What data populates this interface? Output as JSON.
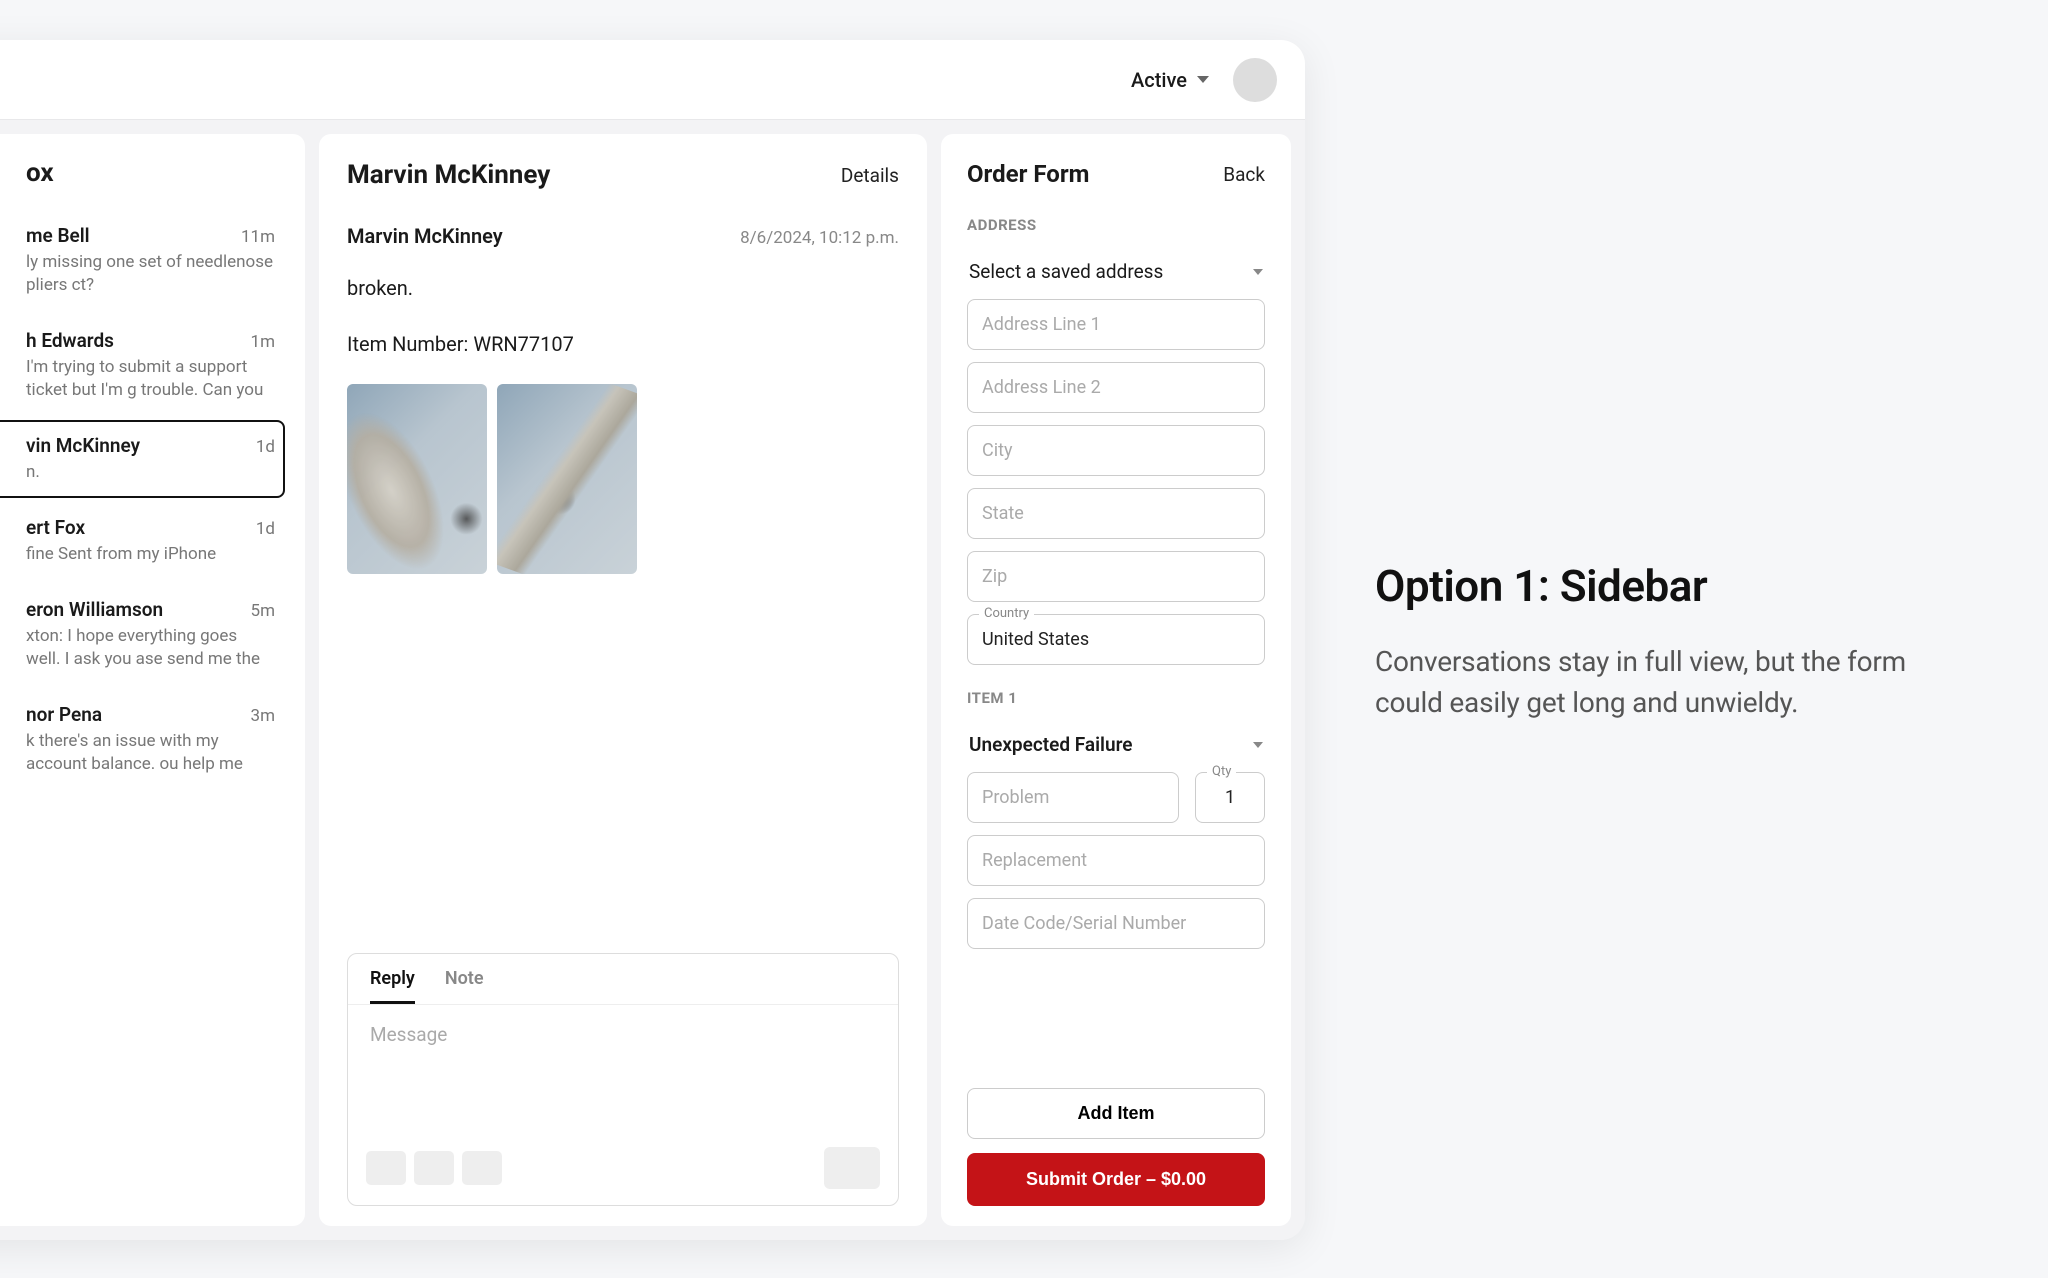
{
  "annotation": {
    "title": "Option 1: Sidebar",
    "body": "Conversations stay in full view, but the form could easily get long and unwieldy."
  },
  "header": {
    "status_label": "Active"
  },
  "inbox": {
    "title": "ox",
    "items": [
      {
        "name": "me Bell",
        "time": "11m",
        "preview": "ly missing one set of needlenose pliers ct?",
        "selected": false
      },
      {
        "name": "h Edwards",
        "time": "1m",
        "preview": "I'm trying to submit a support ticket but I'm g trouble. Can you assist me with this?",
        "selected": false
      },
      {
        "name": "vin McKinney",
        "time": "1d",
        "preview": "n.",
        "selected": true
      },
      {
        "name": "ert Fox",
        "time": "1d",
        "preview": "fine  Sent from my iPhone",
        "selected": false
      },
      {
        "name": "eron Williamson",
        "time": "5m",
        "preview": "xton:  I hope everything goes well. I ask you ase send me the invoice for this order.",
        "selected": false
      },
      {
        "name": "nor Pena",
        "time": "3m",
        "preview": "k there's an issue with my account balance. ou help me figure out what's going on?",
        "selected": false
      }
    ]
  },
  "conversation": {
    "title": "Marvin McKinney",
    "details_label": "Details",
    "message": {
      "author": "Marvin McKinney",
      "timestamp": "8/6/2024, 10:12 p.m.",
      "line1": "broken.",
      "line2": "Item Number: WRN77107"
    },
    "composer": {
      "tab_reply": "Reply",
      "tab_note": "Note",
      "placeholder": "Message"
    }
  },
  "order_form": {
    "title": "Order Form",
    "back_label": "Back",
    "address_section_label": "ADDRESS",
    "saved_address_label": "Select a saved address",
    "addr1_placeholder": "Address Line 1",
    "addr2_placeholder": "Address Line 2",
    "city_placeholder": "City",
    "state_placeholder": "State",
    "zip_placeholder": "Zip",
    "country_label": "Country",
    "country_value": "United States",
    "item_section_label": "ITEM 1",
    "failure_select": "Unexpected Failure",
    "problem_placeholder": "Problem",
    "qty_label": "Qty",
    "qty_value": "1",
    "replacement_placeholder": "Replacement",
    "datecode_placeholder": "Date Code/Serial Number",
    "add_item_label": "Add Item",
    "submit_label": "Submit Order – $0.00"
  }
}
